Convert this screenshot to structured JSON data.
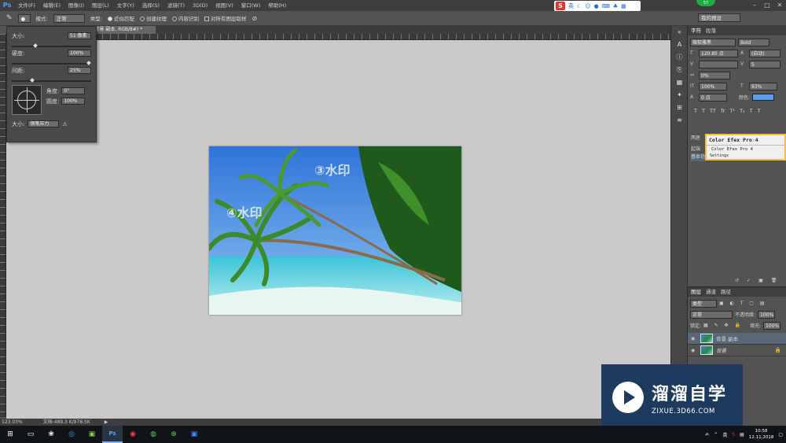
{
  "menubar": {
    "app_logo": "Ps",
    "items": [
      "文件(F)",
      "编辑(E)",
      "图像(I)",
      "图层(L)",
      "文字(Y)",
      "选择(S)",
      "滤镜(T)",
      "3D(D)",
      "视图(V)",
      "窗口(W)",
      "帮助(H)"
    ],
    "ime_toolbar": {
      "logo": "S",
      "lang": "英"
    },
    "badge": "57"
  },
  "options_bar": {
    "mode_label": "模式:",
    "mode_value": "正常",
    "type_label": "类型:",
    "option1": "近似匹配",
    "option2": "创建纹理",
    "option3": "内容识别",
    "sample_all": "对所有图层取样",
    "workspace": "我的预设"
  },
  "document_tab": {
    "title": "(背景 副本, RGB/8#) *"
  },
  "brush_panel": {
    "size_label": "大小:",
    "size_value": "51 像素",
    "hardness_label": "硬度:",
    "hardness_value": "100%",
    "spacing_label": "间距:",
    "spacing_value": "25%",
    "angle_label": "角度:",
    "angle_value": "0°",
    "roundness_label": "圆度:",
    "roundness_value": "100%",
    "size_ctrl_label": "大小:",
    "size_ctrl_value": "钢笔压力",
    "hardness_fraction": 1.0,
    "spacing_fraction": 0.25
  },
  "canvas": {
    "watermark1": "③水印",
    "watermark2": "④水印"
  },
  "character_panel": {
    "tabs": [
      "字符",
      "段落"
    ],
    "font_family": "微软雅黑",
    "font_style": "Bold",
    "font_size": "120.85 点",
    "leading": "(自动)",
    "kerning": "",
    "tracking": "5",
    "scale_label": "0%",
    "vertical_scale": "100%",
    "horizontal_scale": "93%",
    "baseline": "0 点",
    "color_label": "颜色:",
    "color_hex": "#5b9ff0",
    "format_buttons": [
      "T",
      "T",
      "TT",
      "Tr",
      "T¹",
      "T₁",
      "T",
      "T"
    ]
  },
  "color_efex": {
    "title": "Color Efex Pro 4",
    "subtitle": "Color Efex Pro 4",
    "settings": "Settings",
    "left_labels": [
      "两居",
      "起端",
      "基本功"
    ]
  },
  "layers_panel": {
    "tabs": [
      "图层",
      "通道",
      "路径"
    ],
    "filter_label": "类型",
    "blend_mode": "正常",
    "opacity_label": "不透明度:",
    "opacity_value": "100%",
    "lock_label": "锁定:",
    "fill_label": "填充:",
    "fill_value": "100%",
    "layers": [
      {
        "name": "背景 副本",
        "selected": true
      },
      {
        "name": "背景",
        "selected": false
      }
    ]
  },
  "status_bar": {
    "zoom": "123.03%",
    "doc_info": "文档:489.3 K/978.5K"
  },
  "taskbar": {
    "apps": [
      "start",
      "task-view",
      "explorer",
      "browser",
      "notes",
      "photoshop",
      "chrome",
      "wechat",
      "360",
      "qq"
    ],
    "lang": "英",
    "time": "10:58",
    "date": "12.11.2018"
  },
  "logo": {
    "name_cn": "溜溜自学",
    "url": "ZIXUE.3D66.COM"
  }
}
